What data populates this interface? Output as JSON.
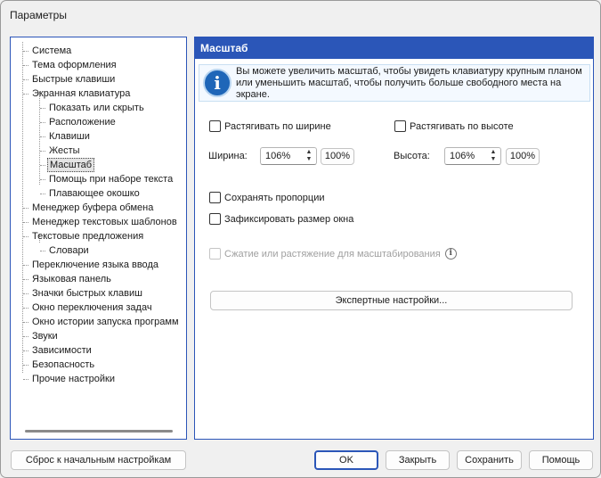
{
  "window": {
    "title": "Параметры"
  },
  "tree": {
    "items": [
      {
        "label": "Система"
      },
      {
        "label": "Тема оформления"
      },
      {
        "label": "Быстрые клавиши"
      },
      {
        "label": "Экранная клавиатура"
      },
      {
        "label": "Показать или скрыть"
      },
      {
        "label": "Расположение"
      },
      {
        "label": "Клавиши"
      },
      {
        "label": "Жесты"
      },
      {
        "label": "Масштаб"
      },
      {
        "label": "Помощь при наборе текста"
      },
      {
        "label": "Плавающее окошко"
      },
      {
        "label": "Менеджер буфера обмена"
      },
      {
        "label": "Менеджер текстовых шаблонов"
      },
      {
        "label": "Текстовые предложения"
      },
      {
        "label": "Словари"
      },
      {
        "label": "Переключение языка ввода"
      },
      {
        "label": "Языковая панель"
      },
      {
        "label": "Значки быстрых клавиш"
      },
      {
        "label": "Окно переключения задач"
      },
      {
        "label": "Окно истории запуска программ"
      },
      {
        "label": "Звуки"
      },
      {
        "label": "Зависимости"
      },
      {
        "label": "Безопасность"
      },
      {
        "label": "Прочие настройки"
      }
    ],
    "selected": "Масштаб"
  },
  "panel": {
    "title": "Масштаб",
    "info_text": "Вы можете увеличить масштаб, чтобы увидеть клавиатуру крупным планом или уменьшить масштаб, чтобы получить больше свободного места на экране.",
    "stretch_width_label": "Растягивать по ширине",
    "stretch_height_label": "Растягивать по высоте",
    "width_label": "Ширина:",
    "width_value": "106%",
    "width_reset": "100%",
    "height_label": "Высота:",
    "height_value": "106%",
    "height_reset": "100%",
    "keep_proportions_label": "Сохранять пропорции",
    "fix_window_size_label": "Зафиксировать размер окна",
    "compress_stretch_label": "Сжатие или растяжение для масштабирования",
    "expert_button": "Экспертные настройки..."
  },
  "footer": {
    "reset_button": "Сброс к начальным настройкам",
    "ok_button": "OK",
    "close_button": "Закрыть",
    "save_button": "Сохранить",
    "help_button": "Помощь"
  },
  "colors": {
    "accent": "#2b56b8",
    "info_icon": "#1f66b8"
  },
  "icons": [
    "info-icon",
    "info-circle-icon",
    "spin-up-icon",
    "spin-down-icon"
  ]
}
